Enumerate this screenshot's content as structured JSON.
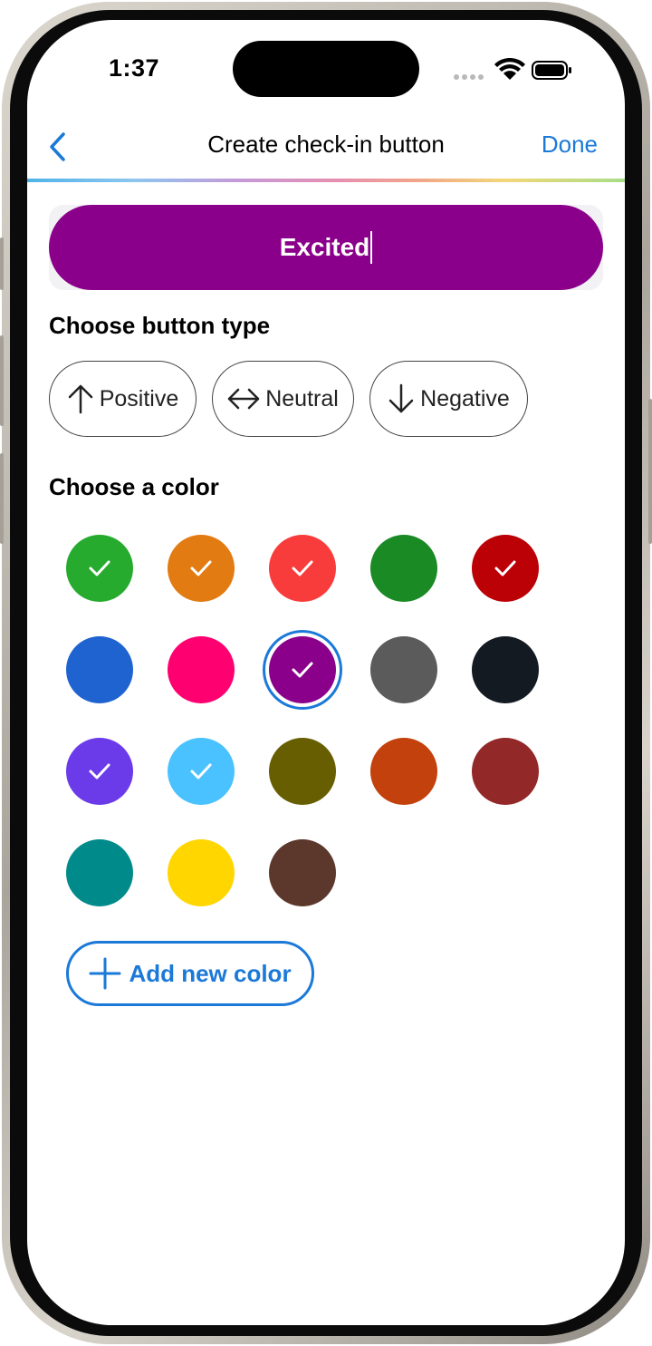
{
  "status_bar": {
    "time": "1:37"
  },
  "nav": {
    "title": "Create check-in button",
    "done_label": "Done"
  },
  "preview": {
    "label": "Excited",
    "color": "#8b008b"
  },
  "button_type": {
    "heading": "Choose button type",
    "options": [
      {
        "label": "Positive",
        "icon": "arrow-up-icon"
      },
      {
        "label": "Neutral",
        "icon": "arrow-left-right-icon"
      },
      {
        "label": "Negative",
        "icon": "arrow-down-icon"
      }
    ]
  },
  "colors": {
    "heading": "Choose a color",
    "selected_index": 7,
    "swatches": [
      {
        "hex": "#26ab2e",
        "checked": true
      },
      {
        "hex": "#e27b12",
        "checked": true
      },
      {
        "hex": "#f83c3c",
        "checked": true
      },
      {
        "hex": "#1a8a24",
        "checked": false
      },
      {
        "hex": "#bb0006",
        "checked": true
      },
      {
        "hex": "#1e63cf",
        "checked": false
      },
      {
        "hex": "#ff0070",
        "checked": false
      },
      {
        "hex": "#8b008b",
        "checked": true
      },
      {
        "hex": "#5b5b5b",
        "checked": false
      },
      {
        "hex": "#141a22",
        "checked": false
      },
      {
        "hex": "#6b3bea",
        "checked": true
      },
      {
        "hex": "#4ac2ff",
        "checked": true
      },
      {
        "hex": "#665e00",
        "checked": false
      },
      {
        "hex": "#c2410c",
        "checked": false
      },
      {
        "hex": "#932828",
        "checked": false
      },
      {
        "hex": "#008a8a",
        "checked": false
      },
      {
        "hex": "#ffd600",
        "checked": false
      },
      {
        "hex": "#5c382c",
        "checked": false
      }
    ],
    "add_label": "Add new color"
  },
  "accent": "#1b79d8"
}
